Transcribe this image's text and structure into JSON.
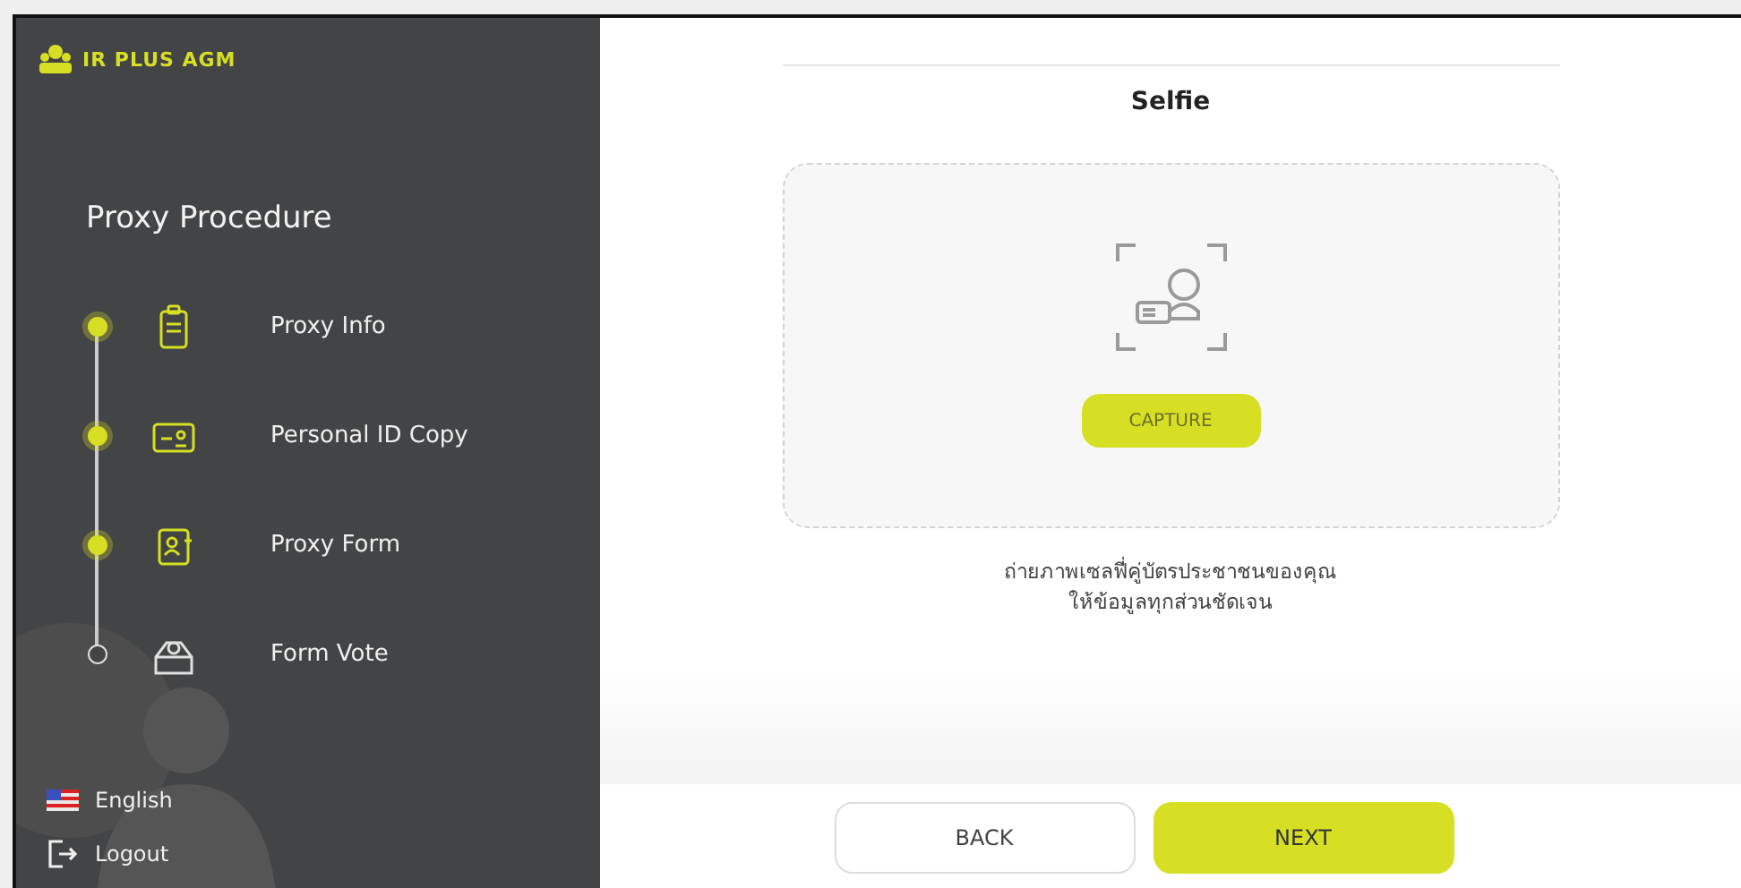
{
  "sidebar": {
    "logo": "IR PLUS AGM",
    "heading": "Proxy Procedure",
    "steps": [
      {
        "label": "Proxy Info",
        "completed": true
      },
      {
        "label": "Personal ID Copy",
        "completed": true
      },
      {
        "label": "Proxy Form",
        "completed": true
      },
      {
        "label": "Form Vote",
        "completed": false
      }
    ],
    "language": "English",
    "logout": "Logout"
  },
  "main": {
    "title": "Selfie",
    "capture_button": "CAPTURE",
    "instruction_lines": [
      "ถ่ายภาพเซลฟี่คู่บัตรประชาชนของคุณ",
      "ให้ข้อมูลทุกส่วนชัดเจน"
    ],
    "buttons": {
      "back": "BACK",
      "next": "NEXT"
    }
  }
}
